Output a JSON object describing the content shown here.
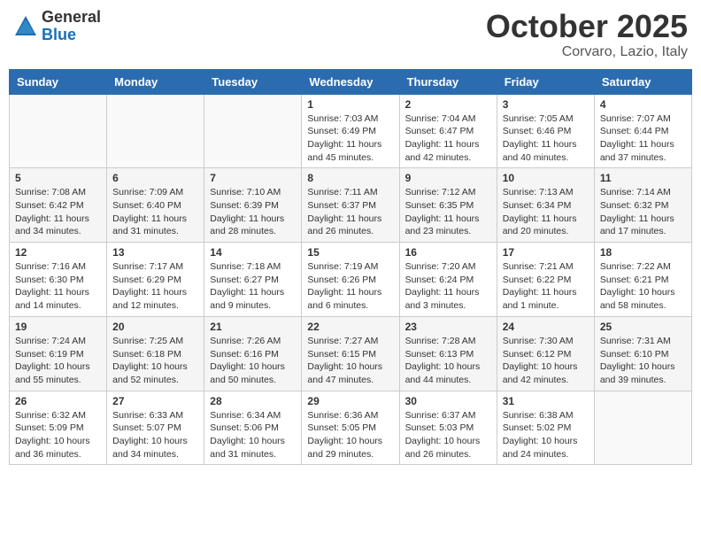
{
  "header": {
    "logo_general": "General",
    "logo_blue": "Blue",
    "month_title": "October 2025",
    "location": "Corvaro, Lazio, Italy"
  },
  "days_of_week": [
    "Sunday",
    "Monday",
    "Tuesday",
    "Wednesday",
    "Thursday",
    "Friday",
    "Saturday"
  ],
  "weeks": [
    [
      {
        "day": "",
        "info": ""
      },
      {
        "day": "",
        "info": ""
      },
      {
        "day": "",
        "info": ""
      },
      {
        "day": "1",
        "info": "Sunrise: 7:03 AM\nSunset: 6:49 PM\nDaylight: 11 hours\nand 45 minutes."
      },
      {
        "day": "2",
        "info": "Sunrise: 7:04 AM\nSunset: 6:47 PM\nDaylight: 11 hours\nand 42 minutes."
      },
      {
        "day": "3",
        "info": "Sunrise: 7:05 AM\nSunset: 6:46 PM\nDaylight: 11 hours\nand 40 minutes."
      },
      {
        "day": "4",
        "info": "Sunrise: 7:07 AM\nSunset: 6:44 PM\nDaylight: 11 hours\nand 37 minutes."
      }
    ],
    [
      {
        "day": "5",
        "info": "Sunrise: 7:08 AM\nSunset: 6:42 PM\nDaylight: 11 hours\nand 34 minutes."
      },
      {
        "day": "6",
        "info": "Sunrise: 7:09 AM\nSunset: 6:40 PM\nDaylight: 11 hours\nand 31 minutes."
      },
      {
        "day": "7",
        "info": "Sunrise: 7:10 AM\nSunset: 6:39 PM\nDaylight: 11 hours\nand 28 minutes."
      },
      {
        "day": "8",
        "info": "Sunrise: 7:11 AM\nSunset: 6:37 PM\nDaylight: 11 hours\nand 26 minutes."
      },
      {
        "day": "9",
        "info": "Sunrise: 7:12 AM\nSunset: 6:35 PM\nDaylight: 11 hours\nand 23 minutes."
      },
      {
        "day": "10",
        "info": "Sunrise: 7:13 AM\nSunset: 6:34 PM\nDaylight: 11 hours\nand 20 minutes."
      },
      {
        "day": "11",
        "info": "Sunrise: 7:14 AM\nSunset: 6:32 PM\nDaylight: 11 hours\nand 17 minutes."
      }
    ],
    [
      {
        "day": "12",
        "info": "Sunrise: 7:16 AM\nSunset: 6:30 PM\nDaylight: 11 hours\nand 14 minutes."
      },
      {
        "day": "13",
        "info": "Sunrise: 7:17 AM\nSunset: 6:29 PM\nDaylight: 11 hours\nand 12 minutes."
      },
      {
        "day": "14",
        "info": "Sunrise: 7:18 AM\nSunset: 6:27 PM\nDaylight: 11 hours\nand 9 minutes."
      },
      {
        "day": "15",
        "info": "Sunrise: 7:19 AM\nSunset: 6:26 PM\nDaylight: 11 hours\nand 6 minutes."
      },
      {
        "day": "16",
        "info": "Sunrise: 7:20 AM\nSunset: 6:24 PM\nDaylight: 11 hours\nand 3 minutes."
      },
      {
        "day": "17",
        "info": "Sunrise: 7:21 AM\nSunset: 6:22 PM\nDaylight: 11 hours\nand 1 minute."
      },
      {
        "day": "18",
        "info": "Sunrise: 7:22 AM\nSunset: 6:21 PM\nDaylight: 10 hours\nand 58 minutes."
      }
    ],
    [
      {
        "day": "19",
        "info": "Sunrise: 7:24 AM\nSunset: 6:19 PM\nDaylight: 10 hours\nand 55 minutes."
      },
      {
        "day": "20",
        "info": "Sunrise: 7:25 AM\nSunset: 6:18 PM\nDaylight: 10 hours\nand 52 minutes."
      },
      {
        "day": "21",
        "info": "Sunrise: 7:26 AM\nSunset: 6:16 PM\nDaylight: 10 hours\nand 50 minutes."
      },
      {
        "day": "22",
        "info": "Sunrise: 7:27 AM\nSunset: 6:15 PM\nDaylight: 10 hours\nand 47 minutes."
      },
      {
        "day": "23",
        "info": "Sunrise: 7:28 AM\nSunset: 6:13 PM\nDaylight: 10 hours\nand 44 minutes."
      },
      {
        "day": "24",
        "info": "Sunrise: 7:30 AM\nSunset: 6:12 PM\nDaylight: 10 hours\nand 42 minutes."
      },
      {
        "day": "25",
        "info": "Sunrise: 7:31 AM\nSunset: 6:10 PM\nDaylight: 10 hours\nand 39 minutes."
      }
    ],
    [
      {
        "day": "26",
        "info": "Sunrise: 6:32 AM\nSunset: 5:09 PM\nDaylight: 10 hours\nand 36 minutes."
      },
      {
        "day": "27",
        "info": "Sunrise: 6:33 AM\nSunset: 5:07 PM\nDaylight: 10 hours\nand 34 minutes."
      },
      {
        "day": "28",
        "info": "Sunrise: 6:34 AM\nSunset: 5:06 PM\nDaylight: 10 hours\nand 31 minutes."
      },
      {
        "day": "29",
        "info": "Sunrise: 6:36 AM\nSunset: 5:05 PM\nDaylight: 10 hours\nand 29 minutes."
      },
      {
        "day": "30",
        "info": "Sunrise: 6:37 AM\nSunset: 5:03 PM\nDaylight: 10 hours\nand 26 minutes."
      },
      {
        "day": "31",
        "info": "Sunrise: 6:38 AM\nSunset: 5:02 PM\nDaylight: 10 hours\nand 24 minutes."
      },
      {
        "day": "",
        "info": ""
      }
    ]
  ]
}
